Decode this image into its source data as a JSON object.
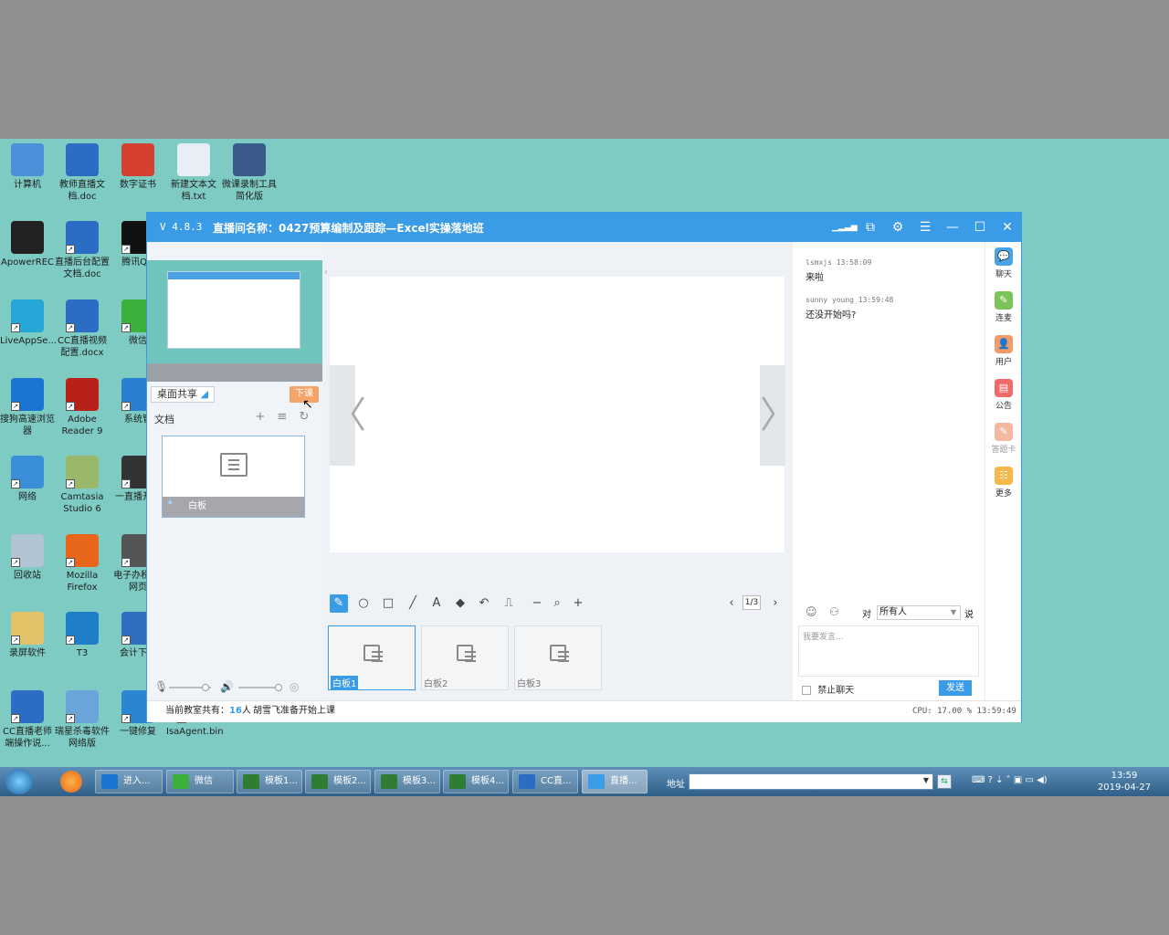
{
  "desktop": {
    "icons": [
      {
        "label": "计算机",
        "color": "#4a90d9"
      },
      {
        "label": "教师直播文档.doc",
        "color": "#2b6cc4"
      },
      {
        "label": "数字证书",
        "color": "#d64030"
      },
      {
        "label": "新建文本文档.txt",
        "color": "#e8eef5"
      },
      {
        "label": "微课录制工具简化版",
        "color": "#3a5a8a"
      },
      {
        "label": "ApowerREC",
        "color": "#222222"
      },
      {
        "label": "直播后台配置文档.doc",
        "color": "#2b6cc4"
      },
      {
        "label": "腾讯QQ",
        "color": "#111111"
      },
      {
        "label": "LiveAppSe...",
        "color": "#25a8d8"
      },
      {
        "label": "CC直播视频配置.docx",
        "color": "#2b6cc4"
      },
      {
        "label": "微信",
        "color": "#3bb13b"
      },
      {
        "label": "搜狗高速浏览器",
        "color": "#1a75d2"
      },
      {
        "label": "Adobe Reader 9",
        "color": "#b8201a"
      },
      {
        "label": "系统管",
        "color": "#2a7fd0"
      },
      {
        "label": "网络",
        "color": "#3a8fd8"
      },
      {
        "label": "Camtasia Studio 6",
        "color": "#9ab86a"
      },
      {
        "label": "一直播开手",
        "color": "#333333"
      },
      {
        "label": "回收站",
        "color": "#b0c4d4"
      },
      {
        "label": "Mozilla Firefox",
        "color": "#e8661c"
      },
      {
        "label": "电子办税厅-网页",
        "color": "#555555"
      },
      {
        "label": "录屏软件",
        "color": "#e2c36a"
      },
      {
        "label": "T3",
        "color": "#1f7ec8"
      },
      {
        "label": "会计下载",
        "color": "#2f6fc0"
      },
      {
        "label": "CC直播老师端操作说...",
        "color": "#2b6cc4"
      },
      {
        "label": "瑞星杀毒软件网络版",
        "color": "#6aa4d8"
      },
      {
        "label": "一键修复",
        "color": "#2a86d0"
      },
      {
        "label": "IsaAgent.bin",
        "color": "#7ecbc4"
      }
    ]
  },
  "window": {
    "version": "V 4.8.3",
    "room_title": "直播间名称：0427预算编制及跟踪—Excel实操落地班"
  },
  "left": {
    "desk_share": "桌面共享",
    "end_class": "下课",
    "doc_label": "文档",
    "doc_card_label": "白板"
  },
  "center": {
    "page": "1/3",
    "thumbs": [
      "白板1",
      "白板2",
      "白板3"
    ]
  },
  "chat": {
    "messages": [
      {
        "user": "lsmxjs",
        "time": "13:58:09",
        "text": "来啦"
      },
      {
        "user": "sunny  young",
        "time": "13:59:48",
        "text": "还没开始吗?"
      }
    ],
    "to_label": "对",
    "to_value": "所有人",
    "say_label": "说",
    "input_placeholder": "我要发言...",
    "ban_label": "禁止聊天",
    "send_label": "发送"
  },
  "sidebar": [
    {
      "label": "聊天",
      "color": "#4aa3e8"
    },
    {
      "label": "连麦",
      "color": "#7cc45a"
    },
    {
      "label": "用户",
      "color": "#f29a6a"
    },
    {
      "label": "公告",
      "color": "#f06a6a"
    },
    {
      "label": "答题卡",
      "color": "#f5b8a0"
    },
    {
      "label": "更多",
      "color": "#f5b94a"
    }
  ],
  "status": {
    "prefix": "当前教室共有：",
    "count": "16",
    "unit": "人",
    "notice": "胡雪飞准备开始上课",
    "cpu": "CPU: 17.00 %",
    "clock": "13:59:49"
  },
  "taskbar": {
    "tasks": [
      {
        "label": "进入...",
        "color": "#1a75d2"
      },
      {
        "label": "微信",
        "color": "#3bb13b"
      },
      {
        "label": "模板1...",
        "color": "#2e7d32"
      },
      {
        "label": "模板2...",
        "color": "#2e7d32"
      },
      {
        "label": "模板3...",
        "color": "#2e7d32"
      },
      {
        "label": "模板4...",
        "color": "#2e7d32"
      },
      {
        "label": "CC直...",
        "color": "#2b6cc4"
      },
      {
        "label": "直播...",
        "color": "#3a9be6"
      }
    ],
    "addr_label": "地址",
    "time": "13:59",
    "date": "2019-04-27"
  }
}
